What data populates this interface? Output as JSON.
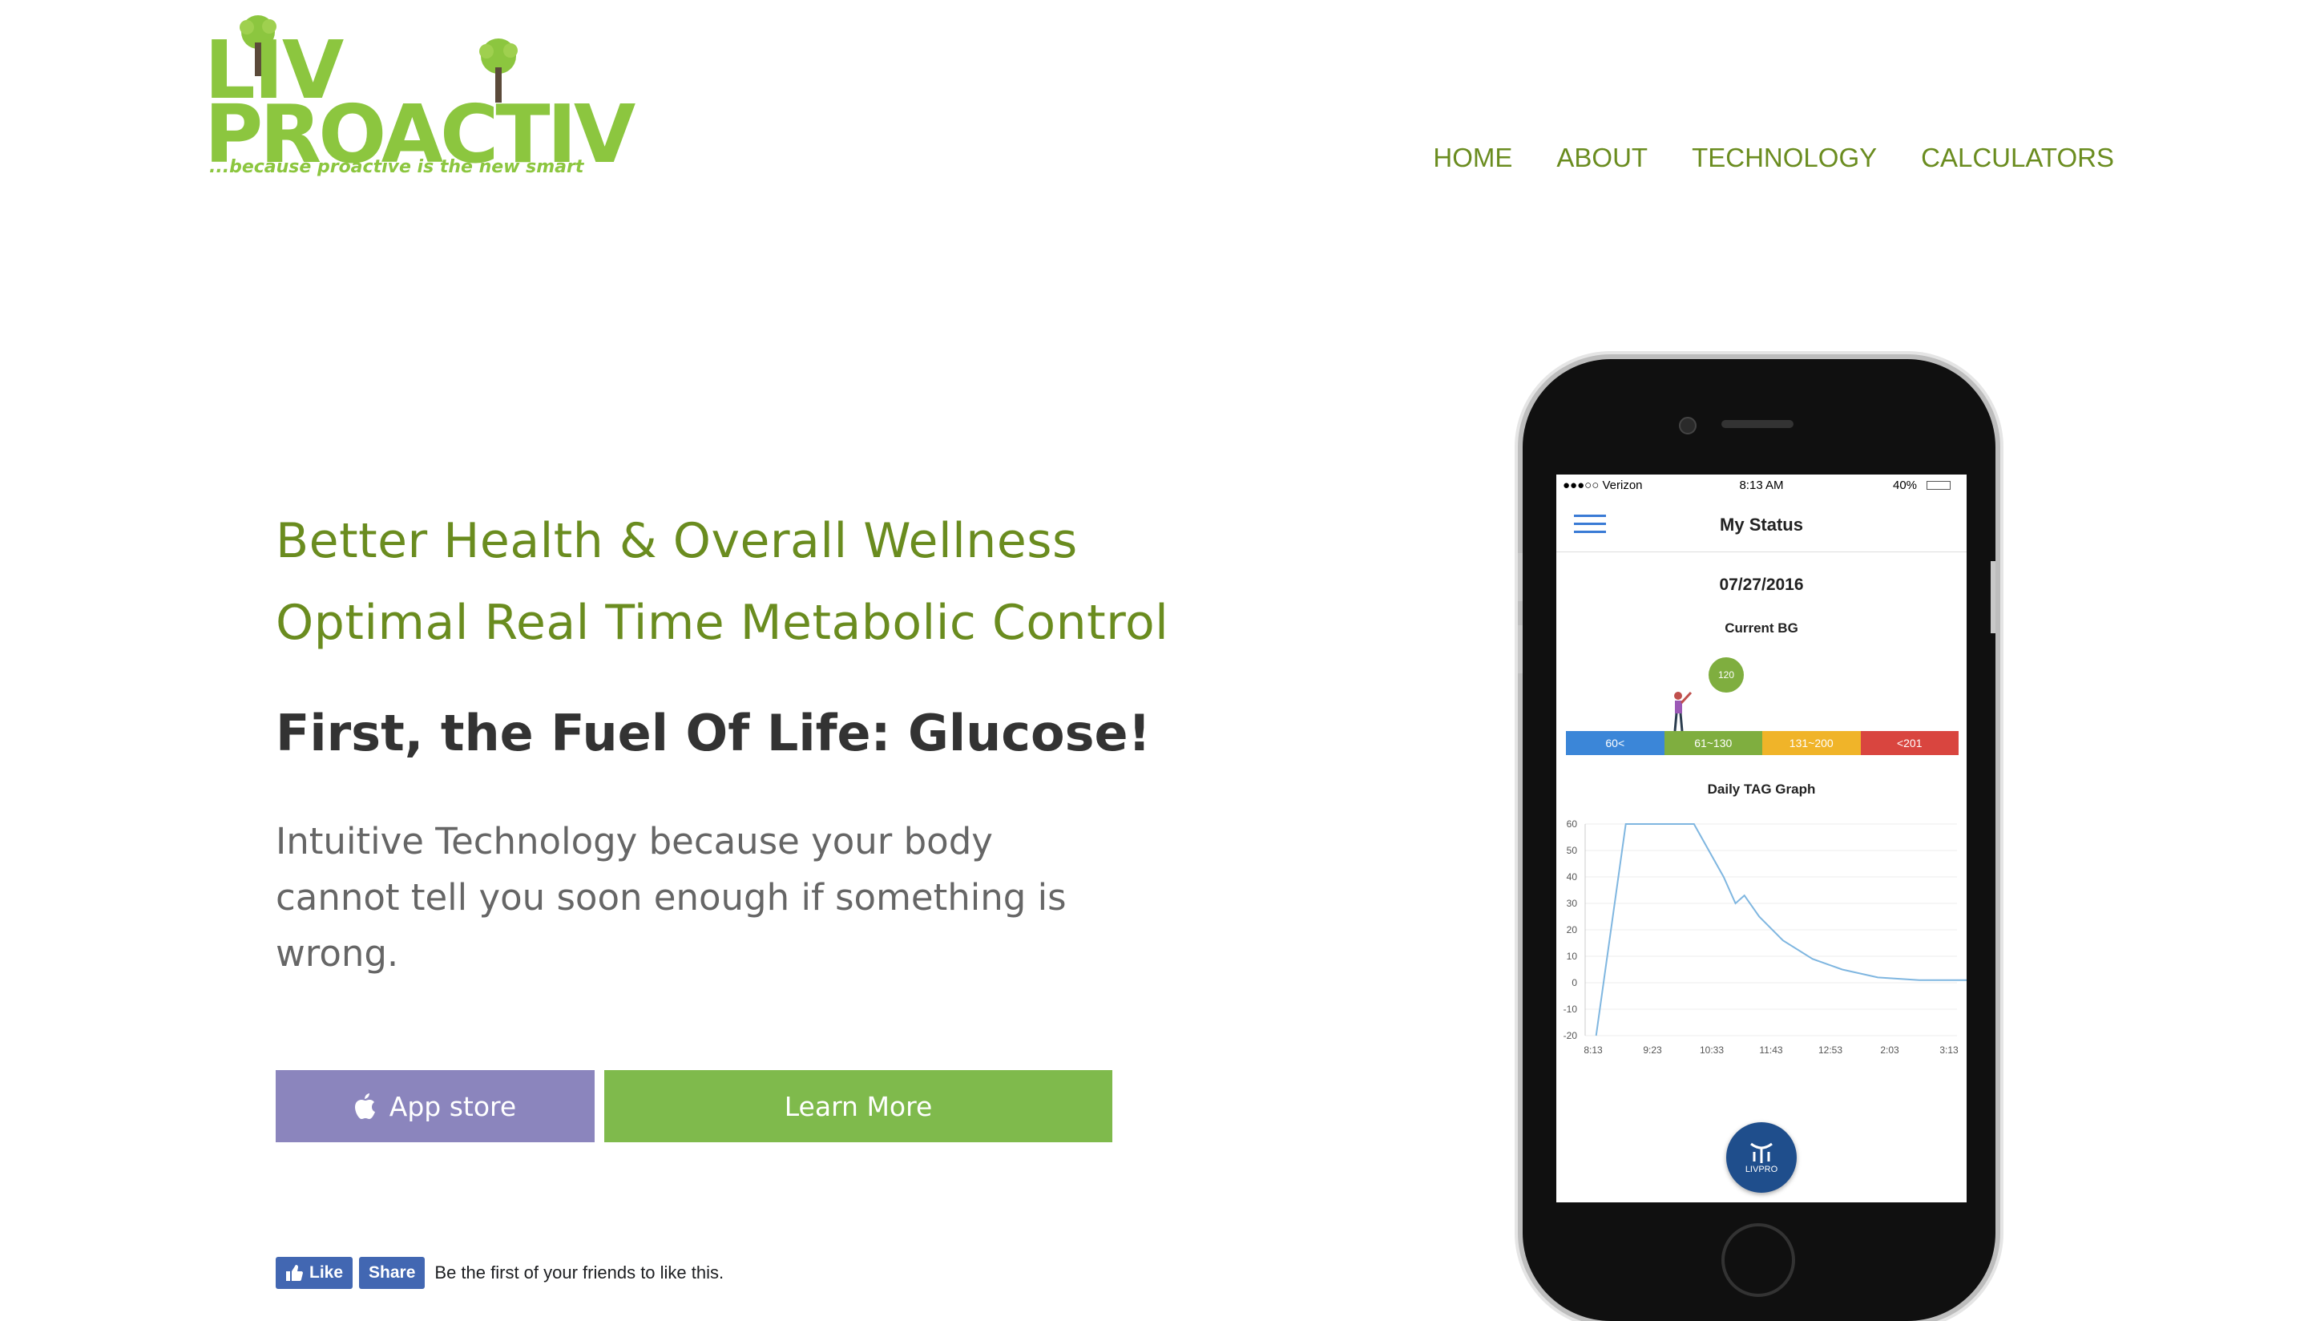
{
  "logo": {
    "line1": "LIV",
    "line2": "PROACTIV",
    "tagline": "...because proactive is the new smart"
  },
  "nav": {
    "items": [
      "HOME",
      "ABOUT",
      "TECHNOLOGY",
      "CALCULATORS"
    ]
  },
  "hero": {
    "headline1": "Better Health & Overall Wellness",
    "headline2": "Optimal Real Time Metabolic Control",
    "subhead": "First, the Fuel Of Life: Glucose!",
    "lead": "Intuitive Technology because your body cannot tell you soon enough if something is wrong.",
    "app_store_label": "App store",
    "learn_more_label": "Learn More"
  },
  "facebook": {
    "like_label": "Like",
    "share_label": "Share",
    "text": "Be the first of your friends to like this."
  },
  "colors": {
    "brand_green": "#8cc63f",
    "nav_green": "#6a8c1f",
    "app_button": "#8b85bd",
    "learn_button": "#7fba4c",
    "facebook_blue": "#4267b2"
  },
  "phone_screen": {
    "carrier": "●●●○○ Verizon",
    "time": "8:13 AM",
    "battery": "40%",
    "title": "My Status",
    "date": "07/27/2016",
    "current_bg_label": "Current BG",
    "current_bg_value": "120",
    "ranges": [
      {
        "label": "60<",
        "color": "#3b86d8"
      },
      {
        "label": "61~130",
        "color": "#7fae3f"
      },
      {
        "label": "131~200",
        "color": "#f0b429"
      },
      {
        "label": "<201",
        "color": "#d9453f"
      }
    ],
    "graph_title": "Daily TAG Graph",
    "app_logo_text": "LIVPRO",
    "chart_data": {
      "type": "line",
      "title": "Daily TAG Graph",
      "x": [
        "8:13",
        "9:23",
        "10:33",
        "11:43",
        "12:53",
        "2:03",
        "3:13"
      ],
      "y_ticks": [
        60,
        50,
        40,
        30,
        20,
        10,
        0,
        -10,
        -20
      ],
      "ylim": [
        -20,
        60
      ],
      "series": [
        {
          "points": [
            [
              0.05,
              -20
            ],
            [
              0.3,
              20
            ],
            [
              0.55,
              60
            ],
            [
              1.7,
              60
            ],
            [
              2.2,
              40
            ],
            [
              2.4,
              30
            ],
            [
              2.55,
              33
            ],
            [
              2.8,
              25
            ],
            [
              3.2,
              16
            ],
            [
              3.7,
              9
            ],
            [
              4.2,
              5
            ],
            [
              4.8,
              2
            ],
            [
              5.5,
              1
            ],
            [
              6.8,
              1
            ]
          ]
        }
      ]
    }
  }
}
